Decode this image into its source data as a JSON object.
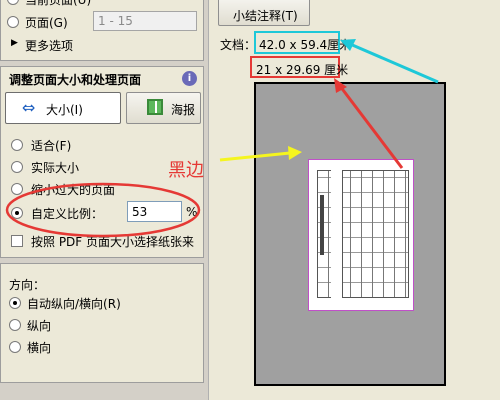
{
  "left": {
    "top_opts": {
      "current_page_label": "当前页面(U)",
      "pages_label": "页面(G)",
      "pages_value": "1 - 15",
      "more_options_label": "更多选项"
    },
    "size_section": {
      "title": "调整页面大小和处理页面",
      "info_icon": "info-icon",
      "btn_size_label": "大小(I)",
      "btn_poster_label": "海报",
      "opt_fit": "适合(F)",
      "opt_actual": "实际大小",
      "opt_shrink": "缩小过大的页面",
      "opt_custom": "自定义比例：",
      "custom_scale": "53",
      "percent": "%",
      "chk_pdf_size": "按照 PDF 页面大小选择纸张来"
    },
    "orientation": {
      "title": "方向：",
      "auto": "自动纵向/横向(R)",
      "portrait": "纵向",
      "landscape": "横向"
    }
  },
  "right": {
    "summarize_btn": "小结注释(T)",
    "doc_label": "文档：",
    "doc_size": "42.0 x 59.4厘米",
    "paper_size": "21 x 29.69 厘米",
    "annotation_black_edge": "黑边"
  },
  "colors": {
    "accent_red": "#e53935",
    "accent_cyan": "#1ec8d8",
    "accent_yellow": "#f5f51e",
    "preview_gray": "#a0a0a0",
    "magenta_border": "#c050c8"
  }
}
